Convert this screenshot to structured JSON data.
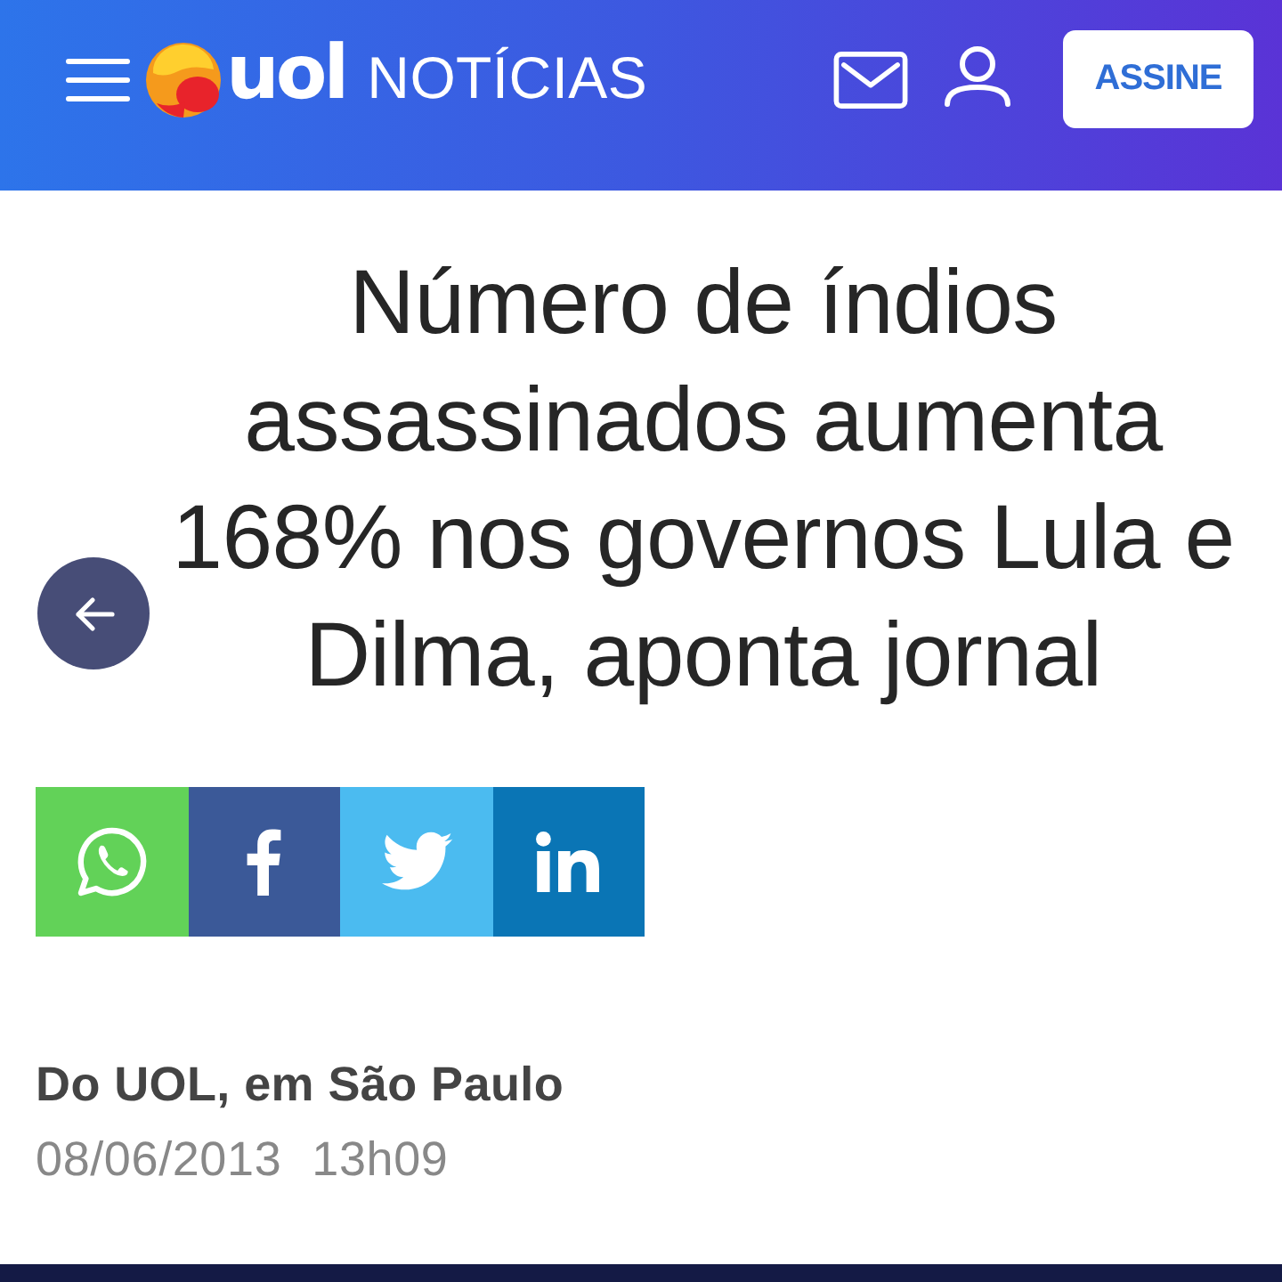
{
  "header": {
    "brand": "uol",
    "section": "NOTÍCIAS",
    "subscribe_button": "ASSINE"
  },
  "article": {
    "headline": "Número de índios assassinados aumenta 168% nos governos Lula e Dilma, aponta jornal",
    "share_buttons": [
      {
        "kind": "whatsapp",
        "color": "#62d258"
      },
      {
        "kind": "facebook",
        "color": "#3b5998"
      },
      {
        "kind": "twitter",
        "color": "#4bbbf0"
      },
      {
        "kind": "linkedin",
        "color": "#0a75b5"
      }
    ],
    "byline": "Do UOL, em São Paulo",
    "date": "08/06/2013",
    "time": "13h09"
  }
}
